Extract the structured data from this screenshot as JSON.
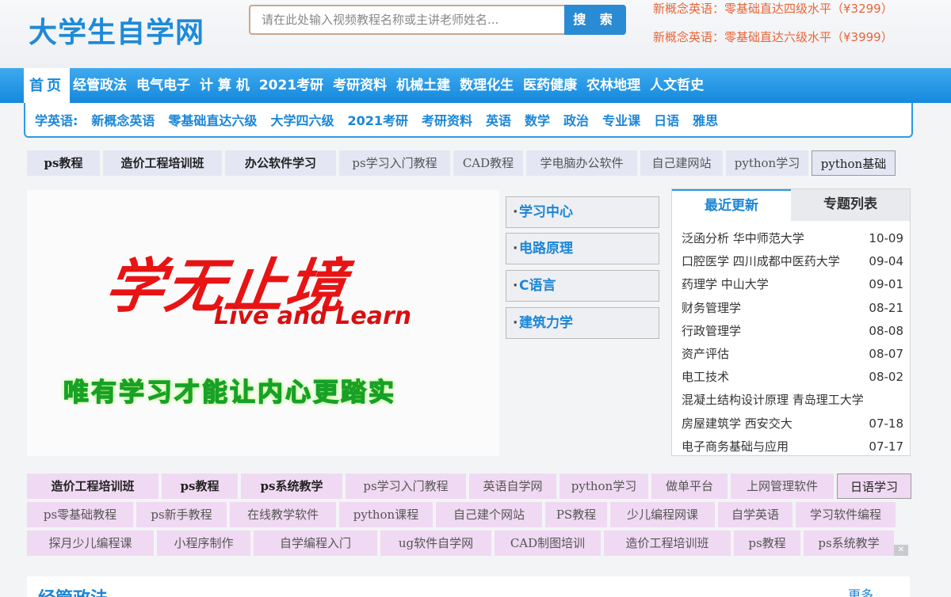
{
  "header": {
    "logo": "大学生自学网",
    "search_placeholder": "请在此处输入视频教程名称或主讲老师姓名...",
    "search_button": "搜 索",
    "promos": [
      "新概念英语：零基础直达四级水平（¥3299）",
      "新概念英语：零基础直达六级水平（¥3999）"
    ]
  },
  "nav": {
    "home": "首页",
    "items": [
      "经管政法",
      "电气电子",
      "计 算 机",
      "2021考研",
      "考研资料",
      "机械土建",
      "数理化生",
      "医药健康",
      "农林地理",
      "人文哲史"
    ]
  },
  "subnav": {
    "items": [
      "学英语:",
      "新概念英语",
      "零基础直达六级",
      "大学四六级",
      "2021考研",
      "考研资料",
      "英语",
      "数学",
      "政治",
      "专业课",
      "日语",
      "雅思"
    ]
  },
  "tags_row1": [
    "ps教程",
    "造价工程培训班",
    "办公软件学习",
    "ps学习入门教程",
    "CAD教程",
    "学电脑办公软件",
    "自己建网站",
    "python学习",
    "python基础"
  ],
  "banner": {
    "title": "学无止境",
    "subtitle_en": "Live and Learn",
    "slogan": "唯有学习才能让内心更踏实"
  },
  "side_buttons": [
    "学习中心",
    "电路原理",
    "C语言",
    "建筑力学"
  ],
  "right_panel": {
    "tab_active": "最近更新",
    "tab_other": "专题列表",
    "items": [
      {
        "title": "泛函分析 华中师范大学",
        "date": "10-09"
      },
      {
        "title": "口腔医学 四川成都中医药大学",
        "date": "09-04"
      },
      {
        "title": "药理学 中山大学",
        "date": "09-01"
      },
      {
        "title": "财务管理学",
        "date": "08-21"
      },
      {
        "title": "行政管理学",
        "date": "08-08"
      },
      {
        "title": "资产评估",
        "date": "08-07"
      },
      {
        "title": "电工技术",
        "date": "08-02"
      },
      {
        "title": "混凝土结构设计原理 青岛理工大学",
        "date": ""
      },
      {
        "title": "房屋建筑学 西安交大",
        "date": "07-18"
      },
      {
        "title": "电子商务基础与应用",
        "date": "07-17"
      }
    ]
  },
  "tags_row2": [
    "造价工程培训班",
    "ps教程",
    "ps系统教学",
    "ps学习入门教程",
    "英语自学网",
    "python学习",
    "做单平台",
    "上网管理软件",
    "日语学习"
  ],
  "tags_row3": [
    "ps零基础教程",
    "ps新手教程",
    "在线教学软件",
    "python课程",
    "自己建个网站",
    "PS教程",
    "少儿编程网课",
    "自学英语",
    "学习软件编程"
  ],
  "tags_row4": [
    "探月少儿编程课",
    "小程序制作",
    "自学编程入门",
    "ug软件自学网",
    "CAD制图培训",
    "造价工程培训班",
    "ps教程",
    "ps系统教学"
  ],
  "bottom": {
    "title": "经管政法",
    "more": "更多"
  }
}
